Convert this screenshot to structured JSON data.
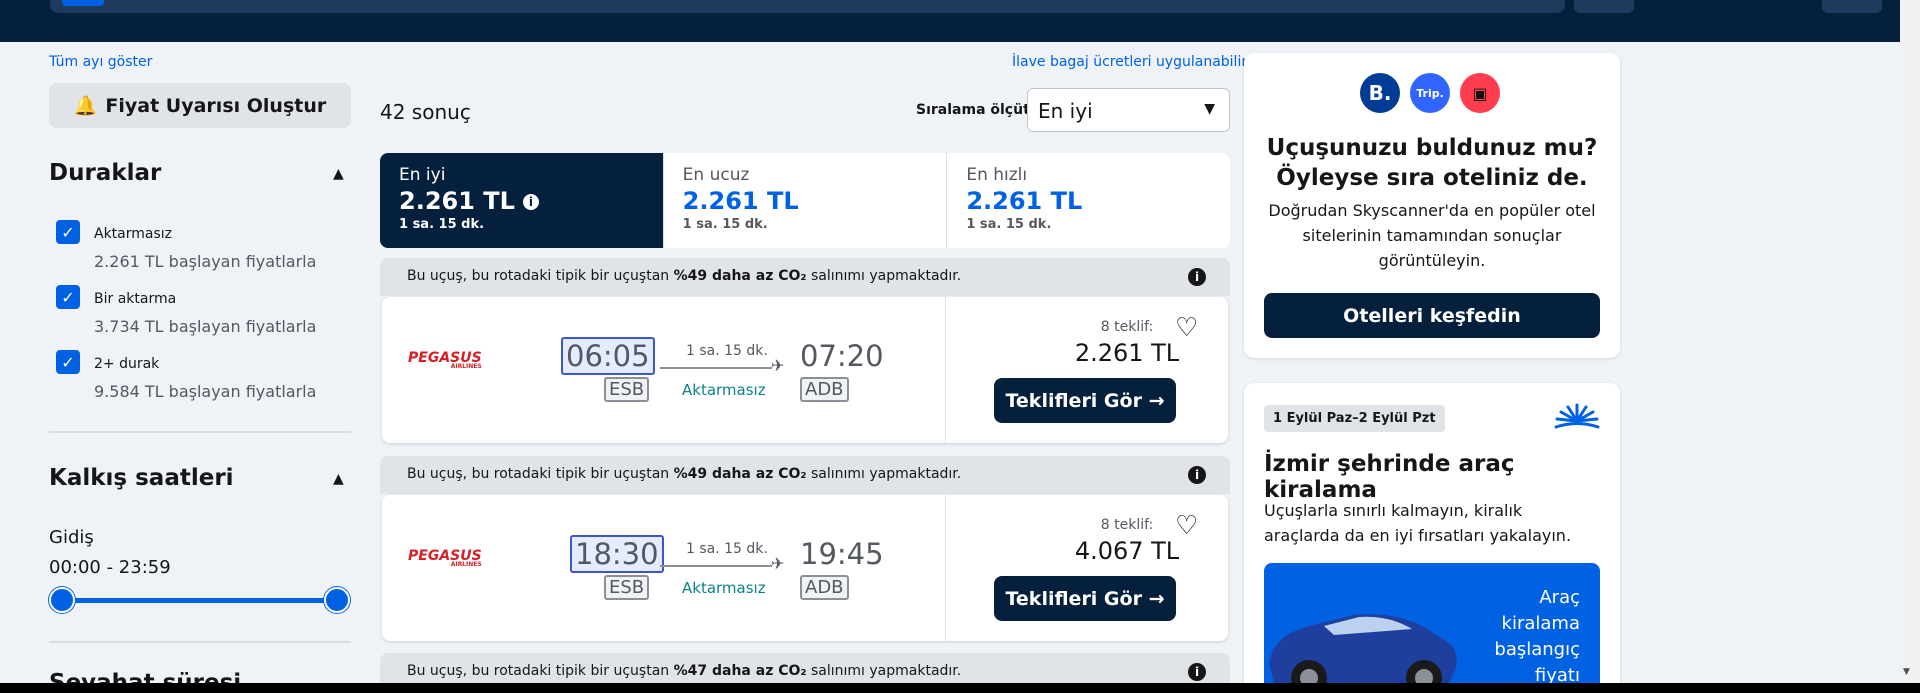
{
  "sidebar": {
    "show_month": "Tüm ayı göster",
    "alert_button": "Fiyat Uyarısı Oluştur",
    "stops_title": "Duraklar",
    "stops": [
      {
        "label": "Aktarmasız",
        "sub": "2.261 TL başlayan fiyatlarla",
        "checked": true
      },
      {
        "label": "Bir aktarma",
        "sub": "3.734 TL başlayan fiyatlarla",
        "checked": true
      },
      {
        "label": "2+ durak",
        "sub": "9.584 TL başlayan fiyatlarla",
        "checked": true
      }
    ],
    "departure_title": "Kalkış saatleri",
    "outbound_label": "Gidiş",
    "outbound_range": "00:00 - 23:59",
    "next_section_partial": "Seyahat süresi"
  },
  "main": {
    "baggage_note": "İlave bagaj ücretleri uygulanabilir",
    "result_count": "42 sonuç",
    "sort_label": "Sıralama ölçütü",
    "sort_value": "En iyi",
    "tabs": [
      {
        "name": "En iyi",
        "price": "2.261 TL",
        "duration": "1 sa. 15 dk.",
        "active": true
      },
      {
        "name": "En ucuz",
        "price": "2.261 TL",
        "duration": "1 sa. 15 dk.",
        "active": false
      },
      {
        "name": "En hızlı",
        "price": "2.261 TL",
        "duration": "1 sa. 15 dk.",
        "active": false
      }
    ],
    "eco_prefix": "Bu uçuş, bu rotadaki tipik bir uçuştan",
    "eco_suffix": "salınımı yapmaktadır.",
    "eco_values": [
      "%49 daha az CO₂",
      "%49 daha az CO₂",
      "%47 daha az CO₂"
    ],
    "flights": [
      {
        "airline": "PEGASUS",
        "airline_sub": "AIRLINES",
        "dep_time": "06:05",
        "dep_iata": "ESB",
        "duration": "1 sa. 15 dk.",
        "stops": "Aktarmasız",
        "arr_time": "07:20",
        "arr_iata": "ADB",
        "offers": "8 teklif:",
        "price": "2.261 TL",
        "button": "Teklifleri Gör →"
      },
      {
        "airline": "PEGASUS",
        "airline_sub": "AIRLINES",
        "dep_time": "18:30",
        "dep_iata": "ESB",
        "duration": "1 sa. 15 dk.",
        "stops": "Aktarmasız",
        "arr_time": "19:45",
        "arr_iata": "ADB",
        "offers": "8 teklif:",
        "price": "4.067 TL",
        "button": "Teklifleri Gör →"
      }
    ]
  },
  "hotel_card": {
    "logos": [
      "B.",
      "Trip.",
      "▣"
    ],
    "title": "Uçuşunuzu buldunuz mu? Öyleyse sıra oteliniz de.",
    "description": "Doğrudan Skyscanner'da en popüler otel sitelerinin tamamından sonuçlar görüntüleyin.",
    "button": "Otelleri keşfedin"
  },
  "car_card": {
    "date_badge": "1 Eylül Paz–2 Eylül Pzt",
    "title": "İzmir şehrinde araç kiralama",
    "description": "Uçuşlarla sınırlı kalmayın, kiralık araçlarda da en iyi fırsatları yakalayın.",
    "promo_text": "Araç kiralama başlangıç fiyatı"
  },
  "colors": {
    "navy": "#05203c",
    "blue": "#0062e3",
    "teal": "#0c838a",
    "pegasus_red": "#d61f26"
  }
}
